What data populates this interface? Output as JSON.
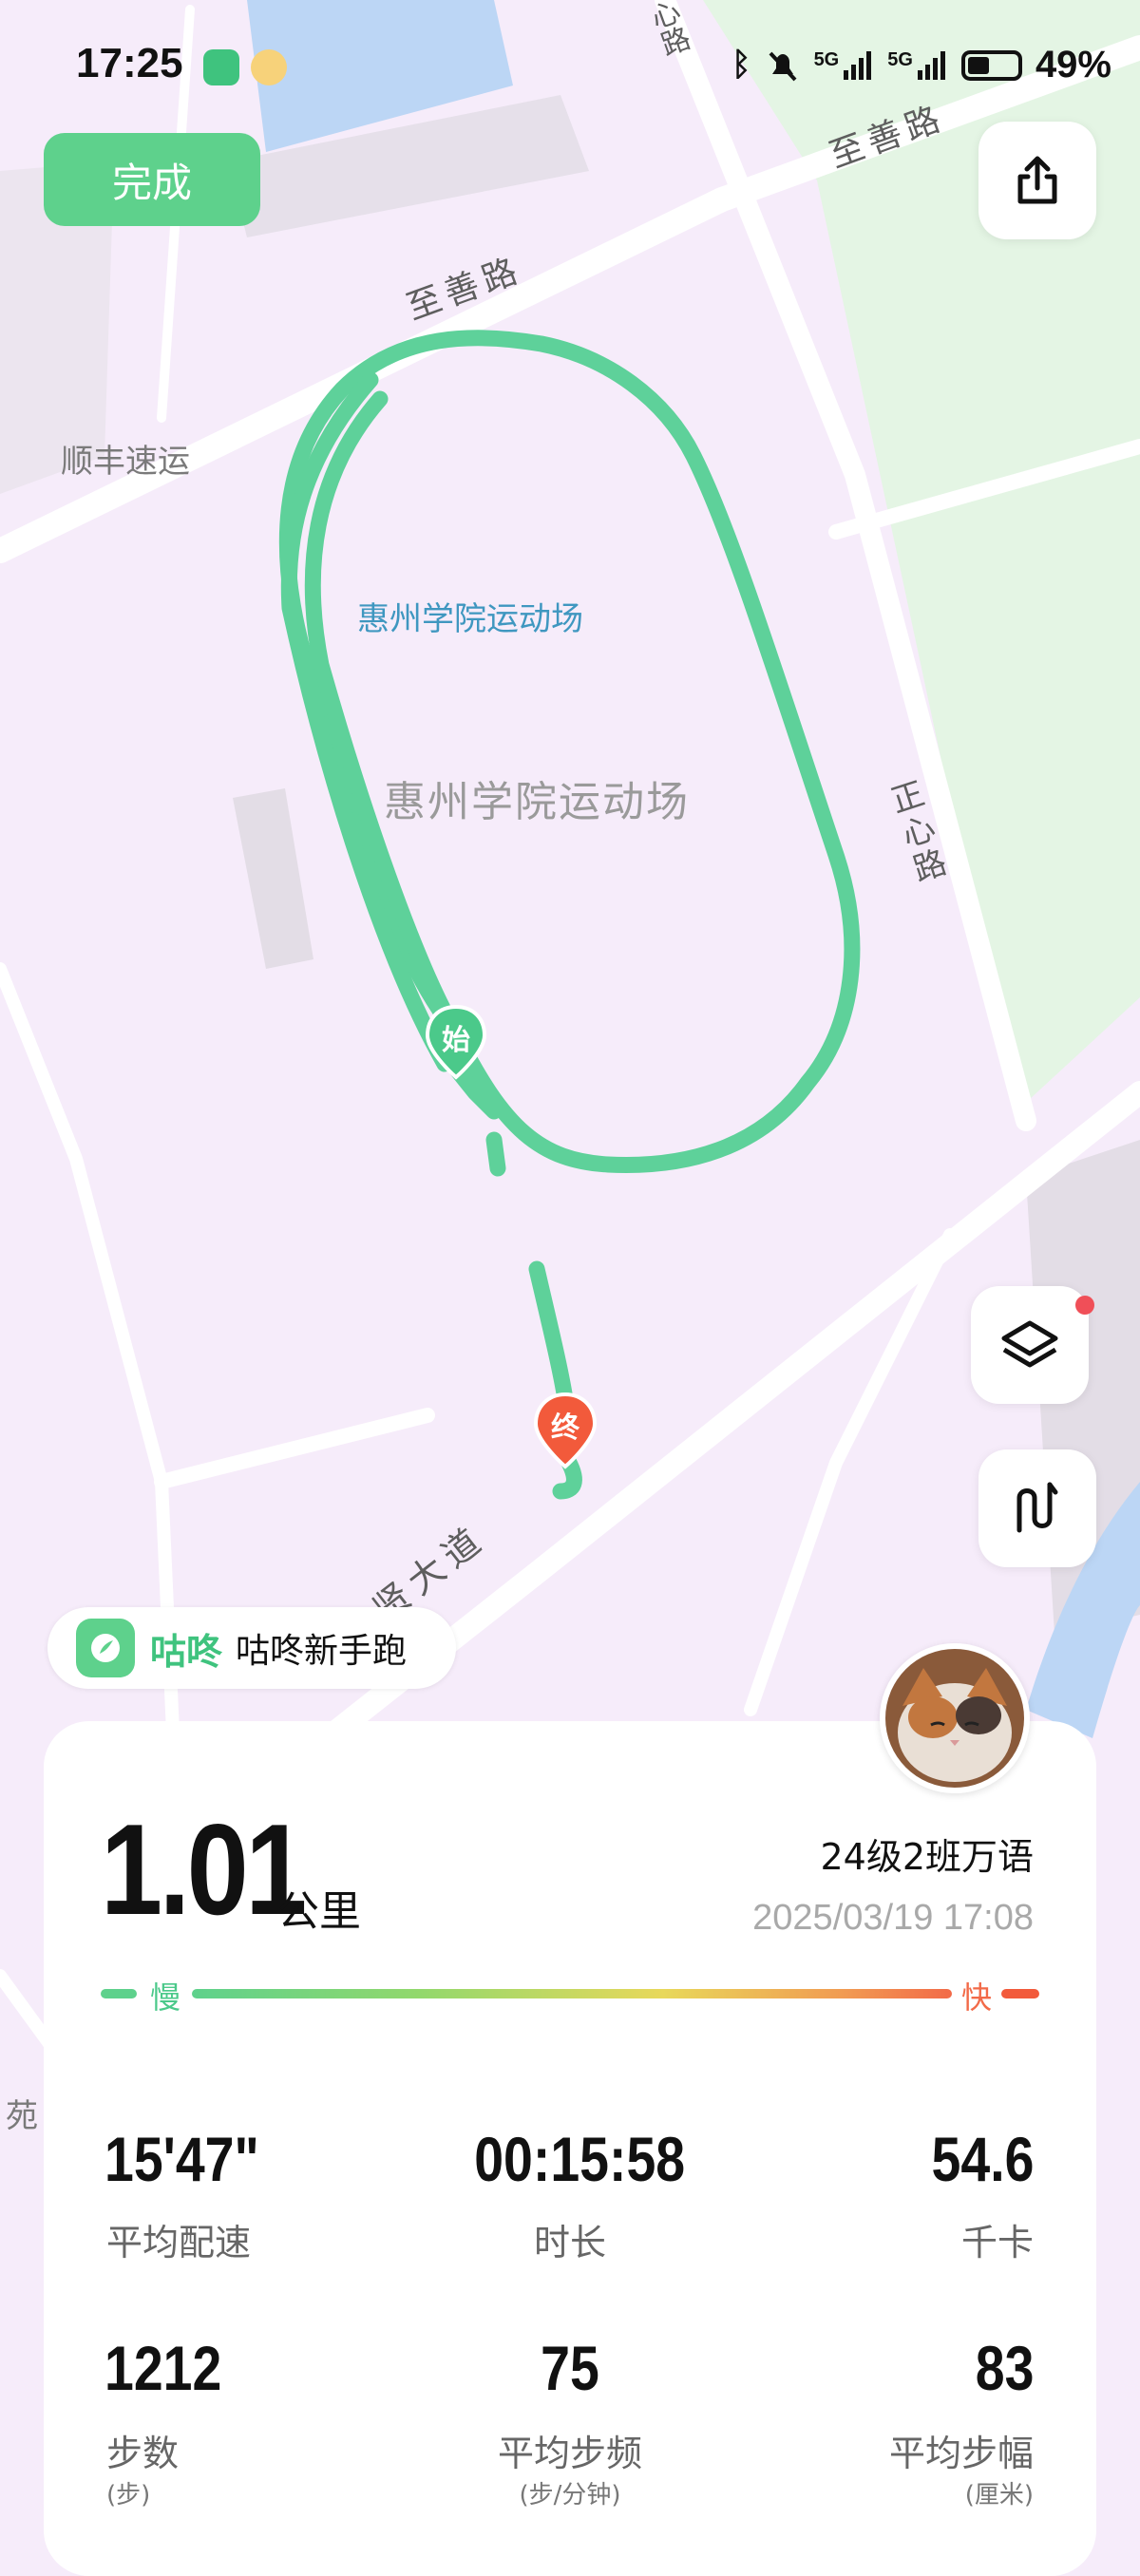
{
  "status_bar": {
    "time": "17:25",
    "network_1": "5G",
    "network_2": "5G",
    "battery": "49%"
  },
  "toolbar": {
    "done_label": "完成",
    "share_icon": "share-icon",
    "layers_icon": "layers-icon",
    "route_icon": "route-icon"
  },
  "map": {
    "road_top_left": "至善路",
    "road_top_right": "至善路",
    "road_right": "正心路",
    "road_bottom": "尚贤大道",
    "road_top_vertical": "心路",
    "poi_shunfeng": "顺丰速运",
    "stadium_label_blue": "惠州学院运动场",
    "stadium_label_gray": "惠州学院运动场",
    "edge_label": "苑",
    "start_marker": "始",
    "end_marker": "终",
    "colors": {
      "route": "#5ed19a",
      "start_marker": "#4bc98a",
      "end_marker": "#f25a3b",
      "green_area": "#e4f5e4",
      "water": "#bcd6f5"
    }
  },
  "brand": {
    "name": "咕咚",
    "title": "咕咚新手跑"
  },
  "summary": {
    "distance": "1.01",
    "distance_unit": "公里",
    "user_name": "24级2班万语",
    "datetime": "2025/03/19 17:08",
    "pace_slow": "慢",
    "pace_fast": "快"
  },
  "stats": [
    {
      "value": "15'47\"",
      "label": "平均配速",
      "sub": ""
    },
    {
      "value": "00:15:58",
      "label": "时长",
      "sub": ""
    },
    {
      "value": "54.6",
      "label": "千卡",
      "sub": ""
    },
    {
      "value": "1212",
      "label": "步数",
      "sub": "(步)"
    },
    {
      "value": "75",
      "label": "平均步频",
      "sub": "(步/分钟)"
    },
    {
      "value": "83",
      "label": "平均步幅",
      "sub": "(厘米)"
    }
  ]
}
